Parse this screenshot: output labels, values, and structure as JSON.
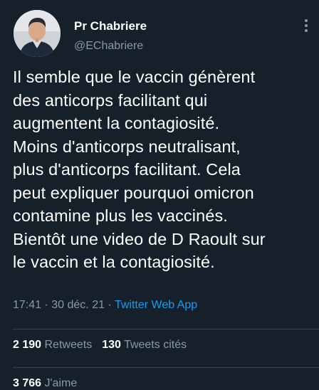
{
  "author": {
    "display_name": "Pr Chabriere",
    "handle": "@EChabriere"
  },
  "tweet": {
    "lines": [
      "Il semble que le vaccin génèrent",
      "des anticorps facilitant qui",
      "augmentent la contagiosité.",
      "Moins d'anticorps neutralisant,",
      "plus d'anticorps facilitant. Cela",
      "peut expliquer pourquoi omicron",
      "contamine plus les vaccinés.",
      "Bientôt une video de D Raoult sur",
      "le vaccin et la contagiosité."
    ],
    "time": "17:41",
    "separator": " · ",
    "date": "30 déc. 21",
    "source_separator": " · ",
    "source": "Twitter Web App"
  },
  "stats": {
    "retweets_count": "2 190",
    "retweets_label": "Retweets",
    "quotes_count": "130",
    "quotes_label": "Tweets cités",
    "likes_count": "3 766",
    "likes_label": "J'aime"
  },
  "colors": {
    "background": "#15202b",
    "text": "#ffffff",
    "secondary": "#8b98a5",
    "link": "#1d9bf0",
    "divider": "#38444d"
  }
}
